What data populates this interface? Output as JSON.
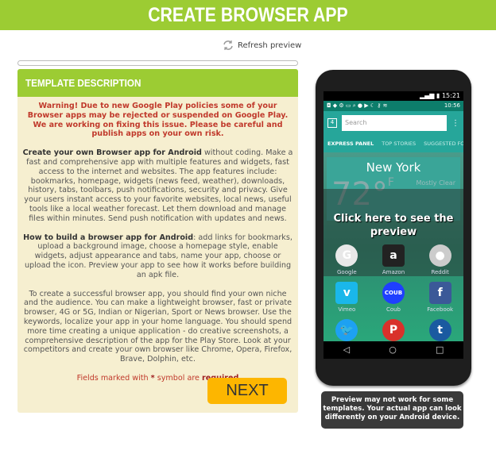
{
  "header": {
    "title": "CREATE BROWSER APP"
  },
  "refresh": {
    "label": "Refresh preview",
    "icon": "refresh-icon"
  },
  "progress": {
    "value": 0
  },
  "panel": {
    "title": "TEMPLATE DESCRIPTION",
    "warning": "Warning! Due to new Google Play policies some of your Browser apps may be rejected or suspended on Google Play. We are working on fixing this issue. Please be careful and publish apps on your own risk.",
    "p1_bold": "Create your own Browser app for Android",
    "p1": " without coding. Make a fast and comprehensive app with multiple features and widgets, fast access to the internet and websites. The app features include: bookmarks, homepage, widgets (news feed, weather), downloads, history, tabs, toolbars, push notifications, security and privacy. Give your users instant access to your favorite websites, local news, useful tools like a local weather forecast. Let them download and manage files within minutes. Send push notification with updates and news.",
    "p2_bold": "How to build a browser app for Android",
    "p2": ": add links for bookmarks, upload a background image, choose a homepage style, enable widgets, adjust appearance and tabs, name your app, choose or upload the icon. Preview your app to see how it works before building an apk file.",
    "p3": "To create a successful browser app, you should find your own niche and the audience. You can make a lightweight browser, fast or private browser, 4G or 5G, Indian or Nigerian, Sport or News browser. Use the keywords, localize your app in your home language. You should spend more time creating a unique application - do creative screenshots, a comprehensive description of the app for the Play Store. Look at your competitors and create your own browser like Chrome, Opera, Firefox, Brave, Dolphin, etc.",
    "req_pre": "Fields marked with ",
    "req_star": "*",
    "req_mid": " symbol are ",
    "req_bold": "required",
    "next": "NEXT"
  },
  "phone": {
    "time1": "15:21",
    "time2": "10:56",
    "tab_count": "4",
    "search_placeholder": "Search",
    "tabs": [
      "EXPRESS PANEL",
      "TOP STORIES",
      "SUGGESTED FOR"
    ],
    "city": "New York",
    "temp": "72°",
    "unit": "F",
    "condition": "Mostly Clear",
    "cta": "Click here to see the preview",
    "apps": [
      {
        "name": "Google",
        "color": "#e8e8e8",
        "glyph": "G"
      },
      {
        "name": "Amazon",
        "color": "#222222",
        "glyph": "a"
      },
      {
        "name": "Reddit",
        "color": "#cccccc",
        "glyph": "●"
      },
      {
        "name": "Vimeo",
        "color": "#1ab7ea",
        "glyph": "v"
      },
      {
        "name": "Coub",
        "color": "#1f3fff",
        "glyph": "COUB"
      },
      {
        "name": "Facebook",
        "color": "#3b5998",
        "glyph": "f"
      },
      {
        "name": "",
        "color": "#1da1f2",
        "glyph": "🐦"
      },
      {
        "name": "",
        "color": "#d9312b",
        "glyph": "P"
      },
      {
        "name": "",
        "color": "#1a5aa0",
        "glyph": "t"
      }
    ],
    "nav": [
      "◁",
      "○",
      "□"
    ]
  },
  "tooltip": "Preview may not work for some templates. Your actual app can look differently on your Android device."
}
